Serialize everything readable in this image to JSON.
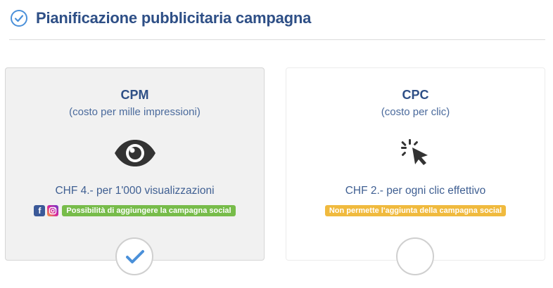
{
  "header": {
    "title": "Pianificazione pubblicitaria campagna",
    "icon": "check-circle-icon"
  },
  "options": [
    {
      "title": "CPM",
      "subtitle": "(costo per mille impressioni)",
      "icon": "eye-icon",
      "price": "CHF 4.- per 1'000 visualizzazioni",
      "social_icons": [
        "facebook-icon",
        "instagram-icon"
      ],
      "badge": "Possibilità di aggiungere la campagna social",
      "badge_color": "#77bc4a",
      "selected": true
    },
    {
      "title": "CPC",
      "subtitle": "(costo per clic)",
      "icon": "cursor-click-icon",
      "price": "CHF 2.- per ogni clic effettivo",
      "badge": "Non permette l'aggiunta della campagna social",
      "badge_color": "#f0ba3e",
      "selected": false
    }
  ],
  "colors": {
    "title": "#2e4f86",
    "accent": "#4a90d9",
    "selected_card_bg": "#f1f1f1"
  }
}
